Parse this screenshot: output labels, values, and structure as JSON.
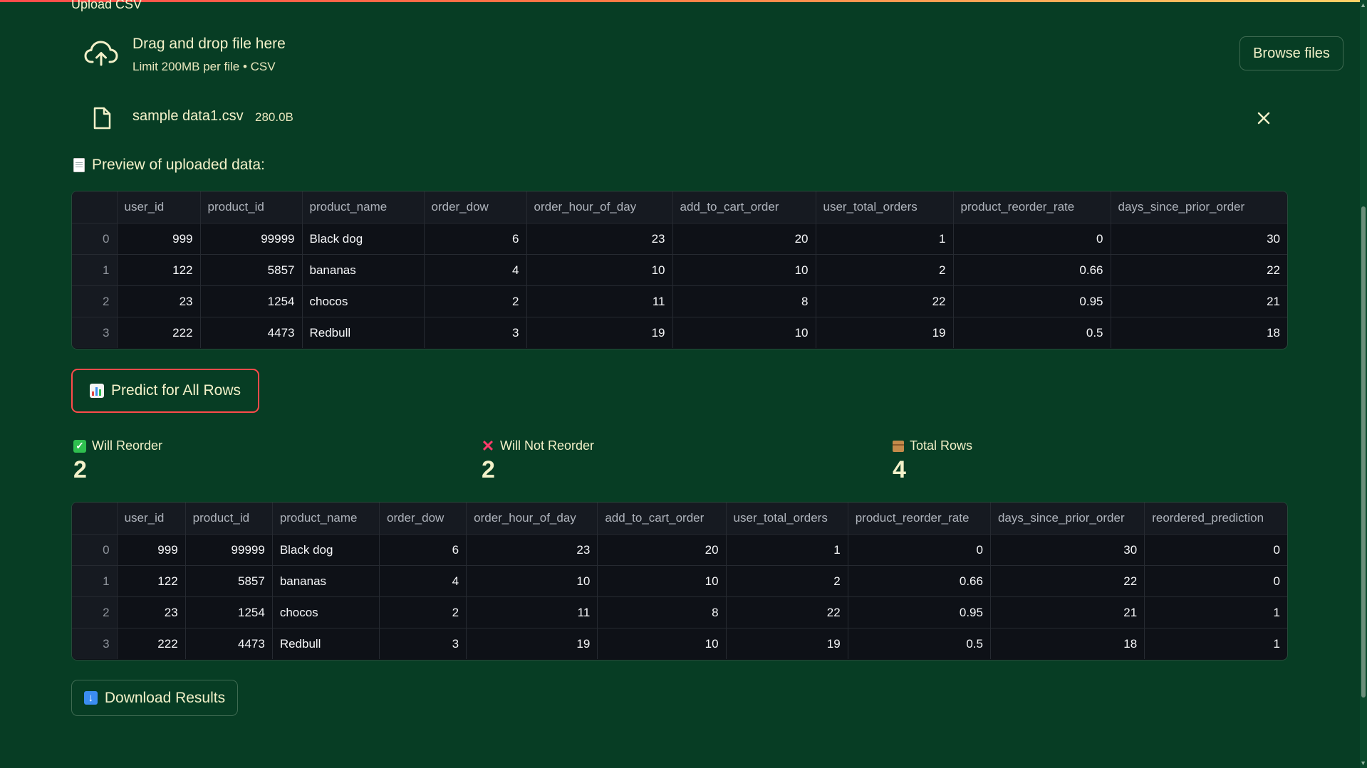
{
  "uploader": {
    "label": "Upload CSV",
    "dropzone_title": "Drag and drop file here",
    "dropzone_subtitle": "Limit 200MB per file • CSV",
    "browse_label": "Browse files",
    "file_name": "sample data1.csv",
    "file_size": "280.0B"
  },
  "preview": {
    "title": "Preview of uploaded data:",
    "columns": [
      "",
      "user_id",
      "product_id",
      "product_name",
      "order_dow",
      "order_hour_of_day",
      "add_to_cart_order",
      "user_total_orders",
      "product_reorder_rate",
      "days_since_prior_order"
    ],
    "rows": [
      [
        "0",
        "999",
        "99999",
        "Black dog",
        "6",
        "23",
        "20",
        "1",
        "0",
        "30"
      ],
      [
        "1",
        "122",
        "5857",
        "bananas",
        "4",
        "10",
        "10",
        "2",
        "0.66",
        "22"
      ],
      [
        "2",
        "23",
        "1254",
        "chocos",
        "2",
        "11",
        "8",
        "22",
        "0.95",
        "21"
      ],
      [
        "3",
        "222",
        "4473",
        "Redbull",
        "3",
        "19",
        "10",
        "19",
        "0.5",
        "18"
      ]
    ]
  },
  "predict_button": "Predict for All Rows",
  "metrics": {
    "will_reorder": {
      "label": "Will Reorder",
      "value": "2"
    },
    "will_not_reorder": {
      "label": "Will Not Reorder",
      "value": "2"
    },
    "total_rows": {
      "label": "Total Rows",
      "value": "4"
    }
  },
  "results": {
    "columns": [
      "",
      "user_id",
      "product_id",
      "product_name",
      "order_dow",
      "order_hour_of_day",
      "add_to_cart_order",
      "user_total_orders",
      "product_reorder_rate",
      "days_since_prior_order",
      "reordered_prediction"
    ],
    "rows": [
      [
        "0",
        "999",
        "99999",
        "Black dog",
        "6",
        "23",
        "20",
        "1",
        "0",
        "30",
        "0"
      ],
      [
        "1",
        "122",
        "5857",
        "bananas",
        "4",
        "10",
        "10",
        "2",
        "0.66",
        "22",
        "0"
      ],
      [
        "2",
        "23",
        "1254",
        "chocos",
        "2",
        "11",
        "8",
        "22",
        "0.95",
        "21",
        "1"
      ],
      [
        "3",
        "222",
        "4473",
        "Redbull",
        "3",
        "19",
        "10",
        "19",
        "0.5",
        "18",
        "1"
      ]
    ]
  },
  "download_button": "Download Results",
  "colors": {
    "background": "#073d24",
    "text": "#f3f1c9",
    "accent": "#ff4b4b",
    "table_bg": "#0e1117"
  }
}
